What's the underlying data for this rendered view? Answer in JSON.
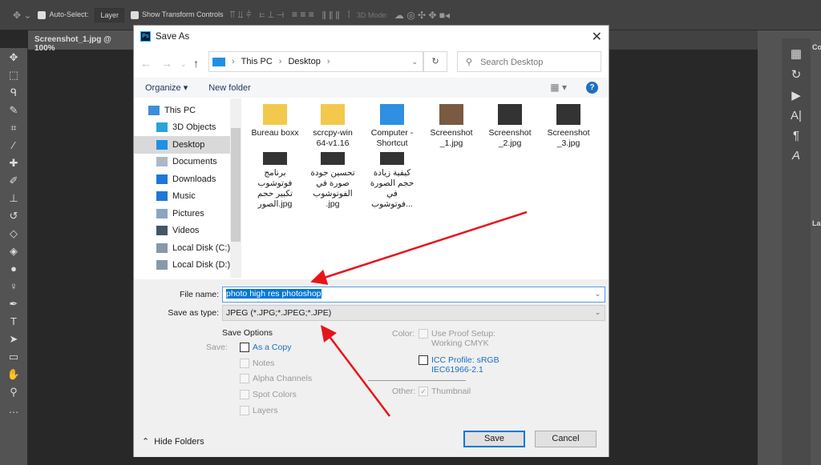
{
  "photoshop": {
    "options_bar": {
      "auto_select_label": "Auto-Select:",
      "auto_select_target": "Layer",
      "show_transform_label": "Show Transform Controls",
      "mode_3d_label": "3D Mode:"
    },
    "document_tab": "Screenshot_1.jpg @ 100%",
    "panel_labels": [
      "Co",
      "La"
    ]
  },
  "dialog": {
    "title": "Save As",
    "breadcrumb": [
      "This PC",
      "Desktop"
    ],
    "search_placeholder": "Search Desktop",
    "organize_label": "Organize ▾",
    "new_folder_label": "New folder",
    "help_label": "?",
    "nav_items": [
      {
        "label": "This PC",
        "icon": "pc-icon",
        "color": "#3b8fd9"
      },
      {
        "label": "3D Objects",
        "icon": "cube-icon",
        "color": "#2aa3d8"
      },
      {
        "label": "Desktop",
        "icon": "desktop-icon",
        "color": "#1e90e6",
        "selected": true
      },
      {
        "label": "Documents",
        "icon": "document-icon",
        "color": "#aab8c8"
      },
      {
        "label": "Downloads",
        "icon": "download-icon",
        "color": "#1e78d7"
      },
      {
        "label": "Music",
        "icon": "music-icon",
        "color": "#1e78d7"
      },
      {
        "label": "Pictures",
        "icon": "pictures-icon",
        "color": "#8aa6c0"
      },
      {
        "label": "Videos",
        "icon": "videos-icon",
        "color": "#445566"
      },
      {
        "label": "Local Disk (C:)",
        "icon": "disk-icon",
        "color": "#8899aa"
      },
      {
        "label": "Local Disk (D:) (",
        "icon": "disk-icon",
        "color": "#8899aa"
      }
    ],
    "files": [
      {
        "name": "Bureau boxx",
        "type": "folder"
      },
      {
        "name": "scrcpy-win 64-v1.16",
        "type": "folder"
      },
      {
        "name": "Computer - Shortcut",
        "type": "shortcut"
      },
      {
        "name": "Screenshot _1.jpg",
        "type": "image"
      },
      {
        "name": "Screenshot _2.jpg",
        "type": "image"
      },
      {
        "name": "Screenshot _3.jpg",
        "type": "image"
      },
      {
        "name": "برنامج فوتوشوب تكبير حجم الصور.jpg",
        "type": "image"
      },
      {
        "name": "تحسين جودة صورة في الفوتوشوب .jpg",
        "type": "image"
      },
      {
        "name": "كيفية زيادة حجم الصورة في فوتوشوب...",
        "type": "image"
      }
    ],
    "file_name_label": "File name:",
    "file_name_value": "photo high res photoshop",
    "save_as_type_label": "Save as type:",
    "save_as_type_value": "JPEG (*.JPG;*.JPEG;*.JPE)",
    "save_options": {
      "heading": "Save Options",
      "save_label": "Save:",
      "as_a_copy": "As a Copy",
      "notes": "Notes",
      "alpha_channels": "Alpha Channels",
      "spot_colors": "Spot Colors",
      "layers": "Layers",
      "color_label": "Color:",
      "use_proof_setup": "Use Proof Setup:",
      "working_cmyk": "Working CMYK",
      "icc_profile": "ICC Profile:  sRGB",
      "icc_profile_2": "IEC61966-2.1",
      "other_label": "Other:",
      "thumbnail": "Thumbnail"
    },
    "hide_folders_label": "Hide Folders",
    "save_button": "Save",
    "cancel_button": "Cancel"
  }
}
